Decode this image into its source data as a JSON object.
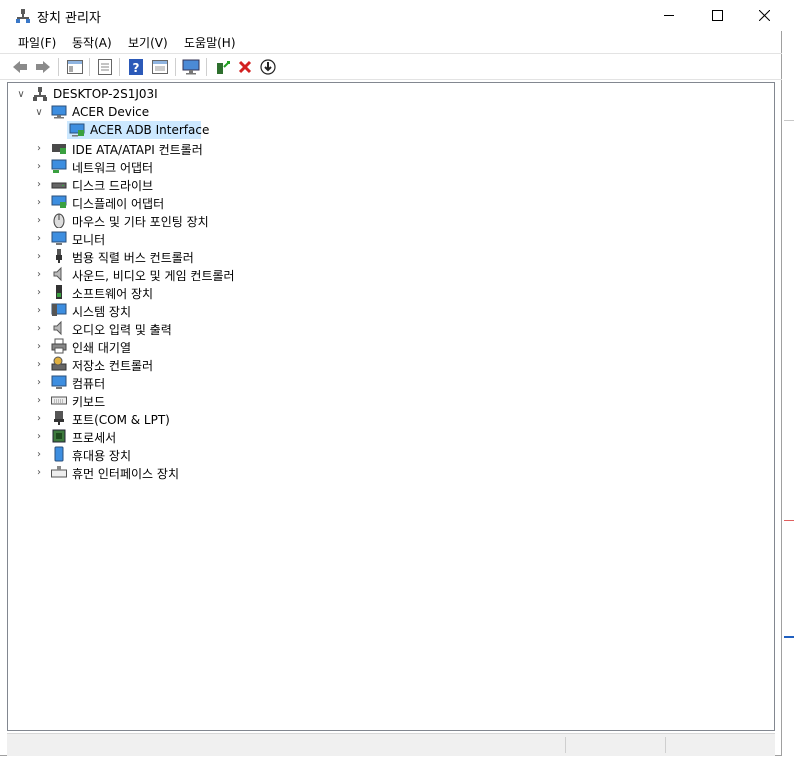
{
  "window": {
    "title": "장치 관리자",
    "controls": {
      "minimize": "minimize",
      "maximize": "maximize",
      "close": "close"
    }
  },
  "menu": [
    "파일(F)",
    "동작(A)",
    "보기(V)",
    "도움말(H)"
  ],
  "toolbar": {
    "icons": [
      "back-arrow-icon",
      "forward-arrow-icon",
      "show-hide-tree-icon",
      "properties-icon",
      "help-icon",
      "view-icon",
      "monitor-scan-icon",
      "update-driver-icon",
      "uninstall-icon",
      "download-icon"
    ]
  },
  "tree": {
    "root": "DESKTOP-2S1J03I",
    "expanded_category": "ACER Device",
    "selected_child": "ACER ADB Interface",
    "categories": [
      "IDE ATA/ATAPI 컨트롤러",
      "네트워크 어댑터",
      "디스크 드라이브",
      "디스플레이 어댑터",
      "마우스 및 기타 포인팅 장치",
      "모니터",
      "범용 직렬 버스 컨트롤러",
      "사운드, 비디오 및 게임 컨트롤러",
      "소프트웨어 장치",
      "시스템 장치",
      "오디오 입력 및 출력",
      "인쇄 대기열",
      "저장소 컨트롤러",
      "컴퓨터",
      "키보드",
      "포트(COM & LPT)",
      "프로세서",
      "휴대용 장치",
      "휴먼 인터페이스 장치"
    ]
  },
  "colors": {
    "selection": "#cce8ff",
    "accent": "#1a5fb4",
    "close_red": "#d32020"
  }
}
